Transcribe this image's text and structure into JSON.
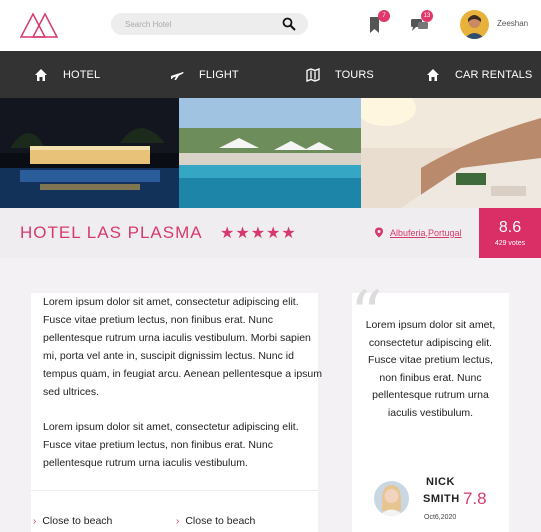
{
  "header": {
    "search_placeholder": "Search Hotel",
    "notifications_count": "7",
    "messages_count": "13",
    "username": "Zeeshan"
  },
  "nav": {
    "items": [
      {
        "label": "HOTEL",
        "icon": "home-icon"
      },
      {
        "label": "FLIGHT",
        "icon": "plane-icon"
      },
      {
        "label": "TOURS",
        "icon": "map-icon"
      },
      {
        "label": "CAR RENTALS",
        "icon": "home-icon"
      }
    ]
  },
  "hotel": {
    "name": "HOTEL LAS PLASMA",
    "stars": "★★★★★",
    "star_count": 5,
    "location": "Albuferia,Portugal",
    "rating": "8.6",
    "votes": "429 votes"
  },
  "description": {
    "p1": "Lorem ipsum dolor sit amet, consectetur adipiscing elit. Fusce vitae pretium lectus, non finibus erat. Nunc pellentesque rutrum urna iaculis vestibulum. Morbi sapien mi, porta vel ante in, suscipit dignissim lectus. Nunc id tempus quam, in feugiat arcu. Aenean pellentesque a ipsum sed ultrices.",
    "p2": "Lorem ipsum dolor sit amet, consectetur adipiscing elit. Fusce vitae pretium lectus, non finibus erat. Nunc pellentesque rutrum urna iaculis vestibulum.",
    "amenities": [
      "Close to beach",
      "Close to beach"
    ]
  },
  "review": {
    "quote": "Lorem ipsum dolor sit amet, consectetur adipiscing elit. Fusce vitae pretium lectus, non finibus erat. Nunc pellentesque rutrum urna iaculis vestibulum.",
    "first_name": "NICK",
    "last_name": "SMITH",
    "score": "7.8",
    "date": "Oct6,2020"
  },
  "colors": {
    "accent": "#d63a6c",
    "nav_bg": "#333333",
    "rating_bg": "#d92e66"
  }
}
